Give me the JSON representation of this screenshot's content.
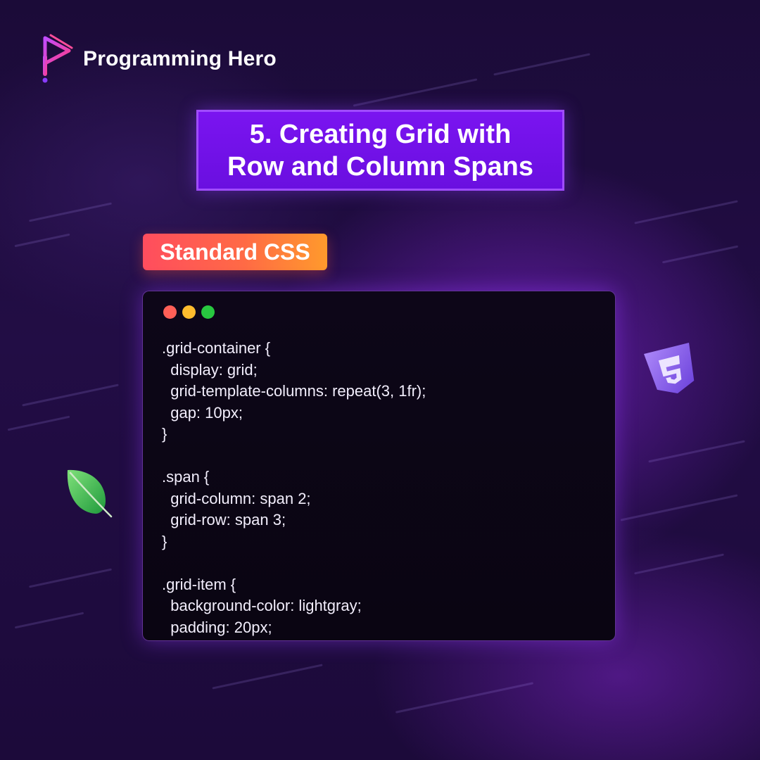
{
  "brand": {
    "name": "Programming Hero"
  },
  "title": {
    "lines": [
      "5. Creating Grid with",
      "Row and Column Spans"
    ]
  },
  "badge": {
    "label": "Standard CSS"
  },
  "code_window": {
    "lines": [
      ".grid-container {",
      "  display: grid;",
      "  grid-template-columns: repeat(3, 1fr);",
      "  gap: 10px;",
      "}",
      "",
      ".span {",
      "  grid-column: span 2;",
      "  grid-row: span 3;",
      "}",
      "",
      ".grid-item {",
      "  background-color: lightgray;",
      "  padding: 20px;"
    ]
  },
  "colors": {
    "title_bg": "#7a14f0",
    "badge_start": "#ff4d5e",
    "badge_end": "#ff9a2c",
    "dot_red": "#ff5f57",
    "dot_yellow": "#febc2e",
    "dot_green": "#28c840"
  },
  "icons": [
    "programming-hero-logo-icon",
    "mongodb-leaf-icon",
    "css3-shield-icon"
  ]
}
